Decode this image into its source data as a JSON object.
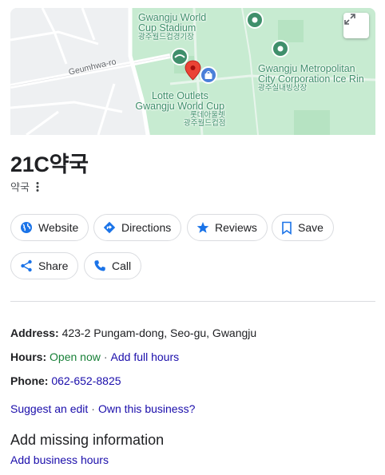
{
  "map": {
    "labels": {
      "stadium_en_1": "Gwangju World",
      "stadium_en_2": "Cup Stadium",
      "stadium_ko": "광주월드컵경기장",
      "road": "Geumhwa-ro",
      "outlets_en_1": "Lotte Outlets",
      "outlets_en_2": "Gwangju World Cup",
      "outlets_ko_1": "롯데아울렛",
      "outlets_ko_2": "광주월드컵점",
      "ice_en_1": "Gwangju Metropolitan",
      "ice_en_2": "City Corporation Ice Rin",
      "ice_ko": "광주실내빙상장"
    },
    "colors": {
      "park": "#c7ebd1",
      "road": "#ffffff",
      "land": "#eef0f2",
      "pin": "#ea4335",
      "poi_green": "#3f8f6b",
      "shop_blue": "#4a7fd9"
    }
  },
  "business": {
    "name": "21C약국",
    "category": "약국"
  },
  "actions": {
    "website": "Website",
    "directions": "Directions",
    "reviews": "Reviews",
    "save": "Save",
    "share": "Share",
    "call": "Call"
  },
  "info": {
    "address_label": "Address:",
    "address_value": "423-2 Pungam-dong, Seo-gu, Gwangju",
    "hours_label": "Hours:",
    "hours_status": "Open now",
    "hours_separator": "·",
    "hours_add": "Add full hours",
    "phone_label": "Phone:",
    "phone_value": "062-652-8825",
    "suggest_edit": "Suggest an edit",
    "own_separator": "·",
    "own_business": "Own this business?"
  },
  "missing": {
    "title": "Add missing information",
    "add_hours": "Add business hours"
  },
  "colors": {
    "link": "#1a0dab",
    "open": "#188038",
    "accent_blue": "#1a73e8"
  }
}
